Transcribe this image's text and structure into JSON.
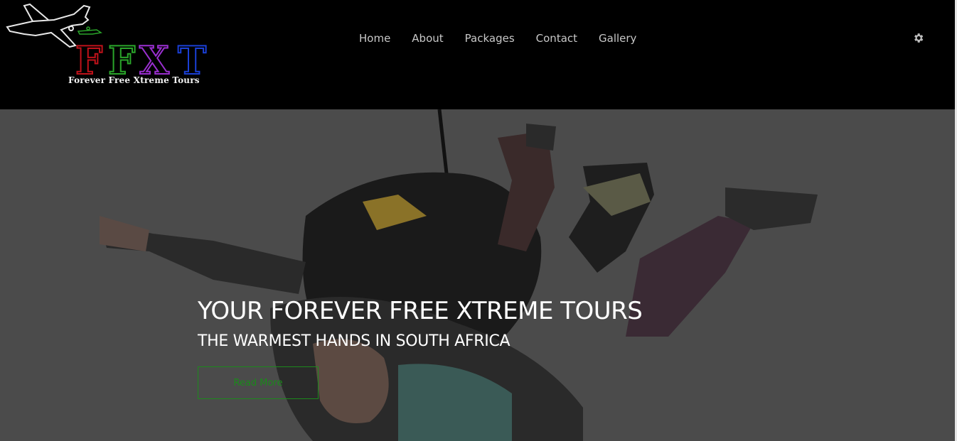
{
  "brand": {
    "logo_letters": [
      "F",
      "F",
      "X",
      "T"
    ],
    "tagline": "Forever Free Xtreme Tours",
    "colors": {
      "f1": "#c0121a",
      "f2": "#2aa52a",
      "x": "#9a2fd0",
      "t": "#1a3fd6"
    }
  },
  "nav": {
    "items": [
      {
        "label": "Home"
      },
      {
        "label": "About"
      },
      {
        "label": "Packages"
      },
      {
        "label": "Contact"
      },
      {
        "label": "Gallery"
      }
    ],
    "settings_icon": "gear-icon"
  },
  "hero": {
    "title": "YOUR FOREVER FREE XTREME TOURS",
    "subtitle": "THE WARMEST HANDS IN SOUTH AFRICA",
    "button_label": "Read More",
    "image": "tandem-skydivers-photo",
    "accent_color": "#1c8a1c"
  }
}
